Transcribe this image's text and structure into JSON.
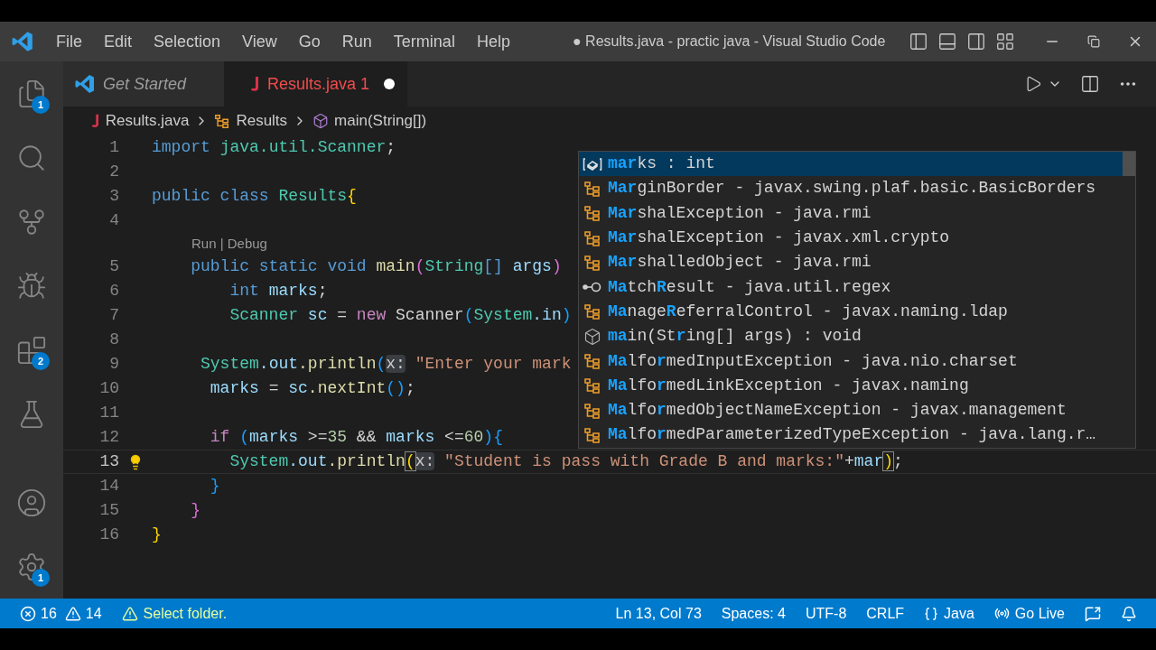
{
  "window": {
    "title": "● Results.java - practic java - Visual Studio Code"
  },
  "menu": [
    "File",
    "Edit",
    "Selection",
    "View",
    "Go",
    "Run",
    "Terminal",
    "Help"
  ],
  "activity_bar": [
    {
      "kind": "explorer",
      "badge": "1"
    },
    {
      "kind": "search"
    },
    {
      "kind": "source-control"
    },
    {
      "kind": "run-debug"
    },
    {
      "kind": "extensions",
      "badge": "2"
    },
    {
      "kind": "testing"
    }
  ],
  "activity_bar_bottom": [
    {
      "kind": "account"
    },
    {
      "kind": "settings",
      "badge": "1"
    }
  ],
  "tabs": [
    {
      "label": "Get Started",
      "kind": "welcome",
      "selected": false,
      "modified": false
    },
    {
      "label": "Results.java 1",
      "kind": "java",
      "selected": true,
      "modified": true
    }
  ],
  "breadcrumb": [
    {
      "label": "Results.java",
      "kind": "java"
    },
    {
      "label": "Results",
      "kind": "class"
    },
    {
      "label": "main(String[])",
      "kind": "method"
    }
  ],
  "code_lines": [
    {
      "number": "1",
      "current": false,
      "tokens": [
        {
          "t": "import ",
          "kind": "kw"
        },
        {
          "t": "java.util.Scanner",
          "kind": "type"
        },
        {
          "t": ";",
          "kind": "op"
        }
      ]
    },
    {
      "number": "2",
      "current": false
    },
    {
      "number": "3",
      "current": false,
      "tokens": [
        {
          "t": "public class ",
          "kind": "kw"
        },
        {
          "t": "Results",
          "kind": "type"
        },
        {
          "t": "{",
          "kind": "b1"
        }
      ]
    },
    {
      "number": "4",
      "current": false
    },
    {
      "number": "5",
      "current": false,
      "codelens": "Run | Debug",
      "tokens": [
        {
          "t": "    public static void ",
          "kind": "kw"
        },
        {
          "t": "main",
          "kind": "fn"
        },
        {
          "t": "(",
          "kind": "b2"
        },
        {
          "t": "String",
          "kind": "type"
        },
        {
          "t": "[] ",
          "kind": "kw"
        },
        {
          "t": "args",
          "kind": "var"
        },
        {
          "t": ")",
          "kind": "b2"
        }
      ]
    },
    {
      "number": "6",
      "current": false,
      "tokens": [
        {
          "t": "        int ",
          "kind": "kw"
        },
        {
          "t": "marks",
          "kind": "var"
        },
        {
          "t": ";",
          "kind": "op"
        }
      ]
    },
    {
      "number": "7",
      "current": false,
      "tokens": [
        {
          "t": "        Scanner ",
          "kind": "type"
        },
        {
          "t": "sc",
          "kind": "var"
        },
        {
          "t": " = ",
          "kind": "op"
        },
        {
          "t": "new ",
          "kind": "ctrl"
        },
        {
          "t": "Scanner",
          "kind": "op"
        },
        {
          "t": "(",
          "kind": "b3"
        },
        {
          "t": "System",
          "kind": "type"
        },
        {
          "t": ".in",
          "kind": "var"
        },
        {
          "t": ")",
          "kind": "b3"
        }
      ]
    },
    {
      "number": "8",
      "current": false
    },
    {
      "number": "9",
      "current": false,
      "tokens": [
        {
          "t": "     System",
          "kind": "type"
        },
        {
          "t": ".out",
          "kind": "var"
        },
        {
          "t": ".println",
          "kind": "fn"
        },
        {
          "t": "(",
          "kind": "b3"
        },
        {
          "t": "x:",
          "kind": "hint"
        },
        {
          "t": " \"Enter your mark",
          "kind": "str"
        }
      ]
    },
    {
      "number": "10",
      "current": false,
      "tokens": [
        {
          "t": "      marks",
          "kind": "var"
        },
        {
          "t": " = ",
          "kind": "op"
        },
        {
          "t": "sc",
          "kind": "var"
        },
        {
          "t": ".nextInt",
          "kind": "fn"
        },
        {
          "t": "()",
          "kind": "b3"
        },
        {
          "t": ";",
          "kind": "op"
        }
      ]
    },
    {
      "number": "11",
      "current": false
    },
    {
      "number": "12",
      "current": false,
      "tokens": [
        {
          "t": "      if ",
          "kind": "ctrl"
        },
        {
          "t": "(",
          "kind": "b3"
        },
        {
          "t": "marks",
          "kind": "var"
        },
        {
          "t": " >=",
          "kind": "op"
        },
        {
          "t": "35",
          "kind": "num"
        },
        {
          "t": " && ",
          "kind": "op"
        },
        {
          "t": "marks",
          "kind": "var"
        },
        {
          "t": " <=",
          "kind": "op"
        },
        {
          "t": "60",
          "kind": "num"
        },
        {
          "t": ")",
          "kind": "b3"
        },
        {
          "t": "{",
          "kind": "b3"
        }
      ]
    },
    {
      "number": "13",
      "current": true,
      "tokens": [
        {
          "t": "        System",
          "kind": "type"
        },
        {
          "t": ".out",
          "kind": "var"
        },
        {
          "t": ".println",
          "kind": "fn"
        },
        {
          "t": "(",
          "kind": "match"
        },
        {
          "t": "x:",
          "kind": "hint"
        },
        {
          "t": " \"Student is pass with Grade B and marks:\"",
          "kind": "str"
        },
        {
          "t": "+",
          "kind": "op"
        },
        {
          "t": "mar",
          "kind": "var"
        },
        {
          "t": ")",
          "kind": "match"
        },
        {
          "t": ";",
          "kind": "op"
        }
      ]
    },
    {
      "number": "14",
      "current": false,
      "tokens": [
        {
          "t": "      }",
          "kind": "b3"
        }
      ]
    },
    {
      "number": "15",
      "current": false,
      "tokens": [
        {
          "t": "    }",
          "kind": "b2"
        }
      ]
    },
    {
      "number": "16",
      "current": false,
      "tokens": [
        {
          "t": "}",
          "kind": "b1"
        }
      ]
    }
  ],
  "suggestions": [
    {
      "kind": "field",
      "selected": true,
      "parts": [
        {
          "text": "mar",
          "matched": true
        },
        {
          "text": "ks",
          "matched": false
        }
      ],
      "detail": ": int"
    },
    {
      "kind": "class",
      "selected": false,
      "parts": [
        {
          "text": "Mar",
          "matched": true
        },
        {
          "text": "ginBorder",
          "matched": false
        }
      ],
      "detail": "- javax.swing.plaf.basic.BasicBorders"
    },
    {
      "kind": "class",
      "selected": false,
      "parts": [
        {
          "text": "Mar",
          "matched": true
        },
        {
          "text": "shalException",
          "matched": false
        }
      ],
      "detail": "- java.rmi"
    },
    {
      "kind": "class",
      "selected": false,
      "parts": [
        {
          "text": "Mar",
          "matched": true
        },
        {
          "text": "shalException",
          "matched": false
        }
      ],
      "detail": "- javax.xml.crypto"
    },
    {
      "kind": "class",
      "selected": false,
      "parts": [
        {
          "text": "Mar",
          "matched": true
        },
        {
          "text": "shalledObject",
          "matched": false
        }
      ],
      "detail": "- java.rmi"
    },
    {
      "kind": "interface",
      "selected": false,
      "parts": [
        {
          "text": "Ma",
          "matched": true
        },
        {
          "text": "tch",
          "matched": false
        },
        {
          "text": "R",
          "matched": true
        },
        {
          "text": "esult",
          "matched": false
        }
      ],
      "detail": "- java.util.regex"
    },
    {
      "kind": "class",
      "selected": false,
      "parts": [
        {
          "text": "Ma",
          "matched": true
        },
        {
          "text": "nage",
          "matched": false
        },
        {
          "text": "R",
          "matched": true
        },
        {
          "text": "eferralControl",
          "matched": false
        }
      ],
      "detail": "- javax.naming.ldap"
    },
    {
      "kind": "method",
      "selected": false,
      "parts": [
        {
          "text": "ma",
          "matched": true
        },
        {
          "text": "in(St",
          "matched": false
        },
        {
          "text": "r",
          "matched": true
        },
        {
          "text": "ing[] args)",
          "matched": false
        }
      ],
      "detail": ": void"
    },
    {
      "kind": "class",
      "selected": false,
      "parts": [
        {
          "text": "Ma",
          "matched": true
        },
        {
          "text": "lfo",
          "matched": false
        },
        {
          "text": "r",
          "matched": true
        },
        {
          "text": "medInputException",
          "matched": false
        }
      ],
      "detail": "- java.nio.charset"
    },
    {
      "kind": "class",
      "selected": false,
      "parts": [
        {
          "text": "Ma",
          "matched": true
        },
        {
          "text": "lfo",
          "matched": false
        },
        {
          "text": "r",
          "matched": true
        },
        {
          "text": "medLinkException",
          "matched": false
        }
      ],
      "detail": "- javax.naming"
    },
    {
      "kind": "class",
      "selected": false,
      "parts": [
        {
          "text": "Ma",
          "matched": true
        },
        {
          "text": "lfo",
          "matched": false
        },
        {
          "text": "r",
          "matched": true
        },
        {
          "text": "medObjectNameException",
          "matched": false
        }
      ],
      "detail": "- javax.management"
    },
    {
      "kind": "class",
      "selected": false,
      "parts": [
        {
          "text": "Ma",
          "matched": true
        },
        {
          "text": "lfo",
          "matched": false
        },
        {
          "text": "r",
          "matched": true
        },
        {
          "text": "medParameterizedTypeException",
          "matched": false
        }
      ],
      "detail": "- java.lang.r…"
    }
  ],
  "status_bar": {
    "errors": "16",
    "warnings": "14",
    "message": "Select folder.",
    "right": [
      {
        "kind": "text",
        "label": "Ln 13, Col 73"
      },
      {
        "kind": "text",
        "label": "Spaces: 4"
      },
      {
        "kind": "text",
        "label": "UTF-8"
      },
      {
        "kind": "text",
        "label": "CRLF"
      },
      {
        "kind": "language",
        "label": "Java"
      },
      {
        "kind": "live",
        "label": "Go Live"
      },
      {
        "kind": "feedback"
      },
      {
        "kind": "bell"
      }
    ]
  }
}
